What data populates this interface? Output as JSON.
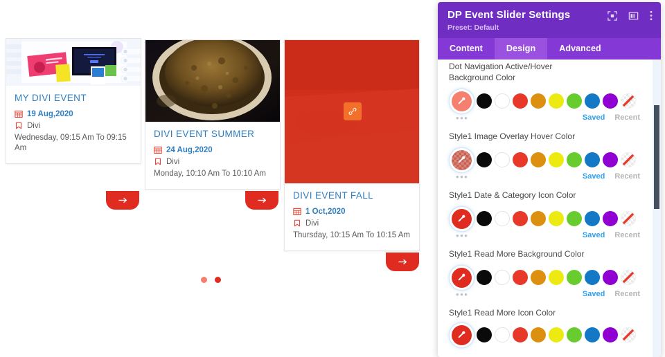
{
  "slider": {
    "cards": [
      {
        "title": "MY DIVI EVENT",
        "date": "19 Aug,2020",
        "category": "Divi",
        "time": "Wednesday, 09:15 Am To 09:15 Am",
        "image_alt": "design-portfolio-mockup",
        "read_more_icon": "arrow-right-icon"
      },
      {
        "title": "DIVI EVENT SUMMER",
        "date": "24 Aug,2020",
        "category": "Divi",
        "time": "Monday, 10:10 Am To 10:10 Am",
        "image_alt": "bowl-of-spice-powder",
        "read_more_icon": "arrow-right-icon"
      },
      {
        "title": "DIVI EVENT FALL",
        "date": "1 Oct,2020",
        "category": "Divi",
        "time": "Thursday, 10:15 Am To 10:15 Am",
        "image_alt": "red-overlay-photo",
        "overlay_icon": "link-icon",
        "read_more_icon": "arrow-right-icon"
      }
    ],
    "dots": [
      {
        "state": "inactive",
        "color": "#f58070"
      },
      {
        "state": "active",
        "color": "#e02b20"
      }
    ],
    "colors": {
      "title": "#2f7fc1",
      "date": "#2f7fc1",
      "icon": "#e8382a",
      "read_more_bg": "#e02b20",
      "overlay": "#d62d19",
      "link_button": "#f2702a"
    }
  },
  "panel": {
    "title": "DP Event Slider Settings",
    "preset": "Preset: Default",
    "head_icons": [
      {
        "name": "focus-icon"
      },
      {
        "name": "layout-panel-icon"
      },
      {
        "name": "more-vertical-icon"
      }
    ],
    "tabs": [
      {
        "label": "Content",
        "active": false
      },
      {
        "label": "Design",
        "active": true
      },
      {
        "label": "Advanced",
        "active": false
      }
    ],
    "accent": "#6f2ec1",
    "tabbar_bg": "#8439d6",
    "tab_active_bg": "#9b51e0",
    "saved_label": "Saved",
    "recent_label": "Recent",
    "ellipsis_label": "•••",
    "palette": [
      {
        "name": "black",
        "hex": "#0a0a0a"
      },
      {
        "name": "white",
        "hex": "#ffffff"
      },
      {
        "name": "red",
        "hex": "#e8382a"
      },
      {
        "name": "orange",
        "hex": "#dd9010"
      },
      {
        "name": "yellow",
        "hex": "#edea11"
      },
      {
        "name": "green",
        "hex": "#68cc2e"
      },
      {
        "name": "blue",
        "hex": "#1379c6"
      },
      {
        "name": "purple",
        "hex": "#9000d2"
      },
      {
        "name": "transparent",
        "hex": "transparent"
      }
    ],
    "fields": [
      {
        "label": "Dot Navigation Active/Hover Background Color",
        "current": "#f58070",
        "current_kind": "solid",
        "clipped": true
      },
      {
        "label": "Style1 Image Overlay Hover Color",
        "current": "#d46a5c",
        "current_kind": "checker",
        "clipped": false
      },
      {
        "label": "Style1 Date & Category Icon Color",
        "current": "#e02b20",
        "current_kind": "solid",
        "clipped": false
      },
      {
        "label": "Style1 Read More Background Color",
        "current": "#e02b20",
        "current_kind": "solid",
        "clipped": false
      },
      {
        "label": "Style1 Read More Icon Color",
        "current": "#e02b20",
        "current_kind": "solid",
        "clipped": false
      }
    ],
    "scrollbar": {
      "name": "vertical-scrollbar",
      "thumb_color": "#44505e"
    }
  }
}
